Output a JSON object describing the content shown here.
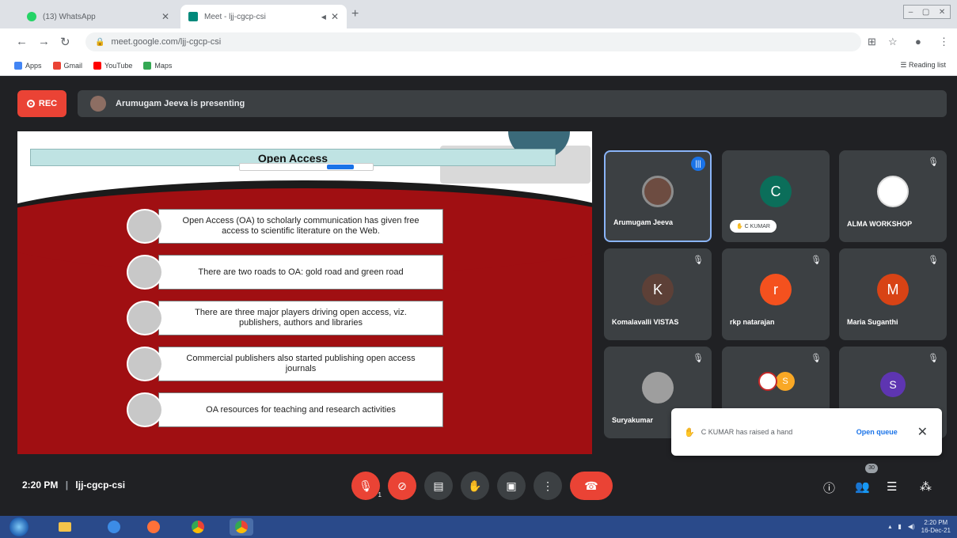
{
  "browser": {
    "tabs": [
      {
        "title": "(13) WhatsApp",
        "active": false
      },
      {
        "title": "Meet - ljj-cgcp-csi",
        "active": true
      }
    ],
    "url": "meet.google.com/ljj-cgcp-csi",
    "bookmarks": [
      "Apps",
      "Gmail",
      "YouTube",
      "Maps"
    ],
    "reading_list": "Reading list"
  },
  "meet": {
    "rec_label": "REC",
    "presenter_text": "Arumugam Jeeva is presenting",
    "slide": {
      "title": "Open Access",
      "bullets": [
        "Open Access (OA) to scholarly communication has given free access to scientific literature on the Web.",
        "There are two roads to OA: gold road and green road",
        "There are three major players driving open access, viz. publishers, authors and libraries",
        "Commercial publishers also started publishing open access journals",
        "OA resources for teaching and research activities"
      ]
    },
    "participants": [
      {
        "name": "Arumugam Jeeva",
        "initial": "",
        "color": "#6d4c41",
        "speaking": true
      },
      {
        "name": "C KUMAR",
        "initial": "C",
        "color": "#0b6e5a",
        "hand_raised": true
      },
      {
        "name": "ALMA WORKSHOP",
        "initial": "",
        "color": "#ffffff"
      },
      {
        "name": "Komalavalli VISTAS",
        "initial": "K",
        "color": "#5d4037"
      },
      {
        "name": "rkp natarajan",
        "initial": "r",
        "color": "#f4511e"
      },
      {
        "name": "Maria Suganthi",
        "initial": "M",
        "color": "#d84315"
      },
      {
        "name": "Suryakumar",
        "initial": "",
        "color": "#9e9e9e"
      },
      {
        "name": "",
        "initial": "S",
        "color": "#f9a825"
      },
      {
        "name": "",
        "initial": "S",
        "color": "#5e35b1"
      }
    ],
    "toast": {
      "message": "C KUMAR has raised a hand",
      "action": "Open queue"
    },
    "time": "2:20 PM",
    "meeting_code": "ljj-cgcp-csi",
    "raised_hands_count": "1",
    "people_count": "30"
  },
  "taskbar": {
    "time": "2:20 PM",
    "date": "16-Dec-21"
  }
}
